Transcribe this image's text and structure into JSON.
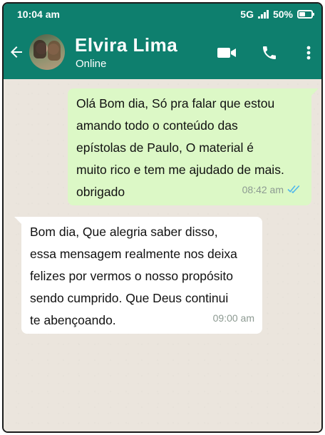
{
  "statusbar": {
    "time": "10:04 am",
    "network": "5G",
    "battery_percent": "50%",
    "battery_level": 0.5
  },
  "header": {
    "contact_name": "Elvira Lima",
    "contact_status": "Online",
    "icons": [
      "back-arrow-icon",
      "video-call-icon",
      "phone-icon",
      "more-options-icon"
    ],
    "color": "#0e7f6e"
  },
  "messages": [
    {
      "direction": "outgoing",
      "text": "Olá Bom dia, Só pra falar que estou\namando todo o conteúdo das\nepístolas de Paulo, O material é\nmuito rico e tem me ajudado de mais.\nobrigado",
      "time": "08:42 am",
      "read": true
    },
    {
      "direction": "incoming",
      "text": "Bom dia, Que alegria saber disso,\nessa mensagem realmente nos deixa\nfelizes por vermos o nosso propósito\nsendo cumprido. Que Deus continui\nte abençoando.",
      "time": "09:00 am"
    }
  ],
  "colors": {
    "outgoing_bubble": "#dcf8c6",
    "incoming_bubble": "#ffffff",
    "read_ticks": "#4fb6ec"
  }
}
